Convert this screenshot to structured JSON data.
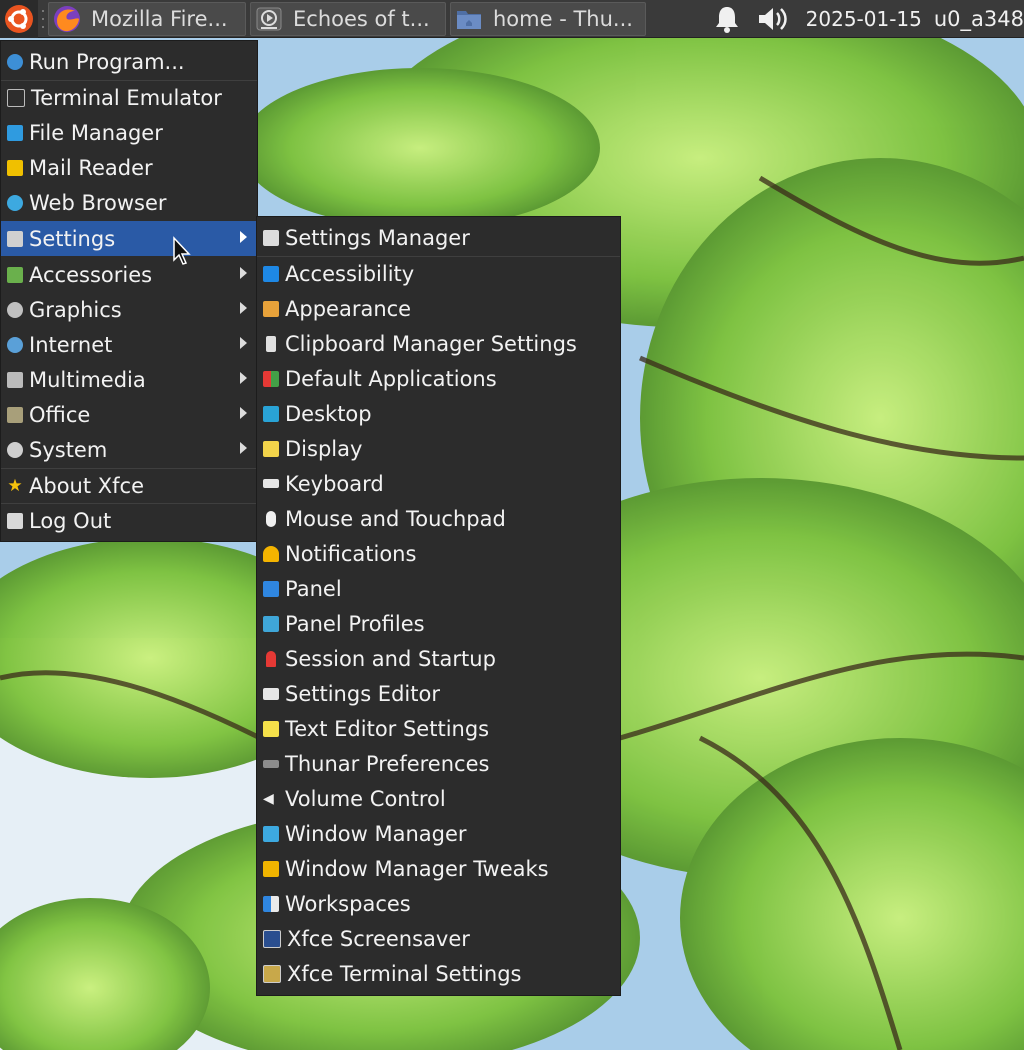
{
  "panel": {
    "tasks": [
      {
        "label": "Mozilla Fire...",
        "icon": "firefox-icon"
      },
      {
        "label": "Echoes of t...",
        "icon": "media-player-icon"
      },
      {
        "label": "home - Thu...",
        "icon": "folder-icon"
      }
    ],
    "clock": "2025-01-15",
    "user": "u0_a348"
  },
  "main_menu": {
    "items": [
      {
        "label": "Run Program...",
        "icon": "run-icon",
        "color": "#3d8fd6",
        "submenu": false
      },
      {
        "label": "Terminal Emulator",
        "icon": "terminal-icon",
        "color": "#2d2d2d",
        "submenu": false
      },
      {
        "label": "File Manager",
        "icon": "file-manager-icon",
        "color": "#2f9be0",
        "submenu": false
      },
      {
        "label": "Mail Reader",
        "icon": "mail-icon",
        "color": "#f0c000",
        "submenu": false
      },
      {
        "label": "Web Browser",
        "icon": "globe-icon",
        "color": "#3da9e0",
        "submenu": false
      },
      {
        "label": "Settings",
        "icon": "settings-icon",
        "color": "#d0d0d0",
        "submenu": true,
        "active": true
      },
      {
        "label": "Accessories",
        "icon": "accessories-icon",
        "color": "#6ab04c",
        "submenu": true
      },
      {
        "label": "Graphics",
        "icon": "graphics-icon",
        "color": "#c0c0c0",
        "submenu": true
      },
      {
        "label": "Internet",
        "icon": "internet-icon",
        "color": "#5aa0d8",
        "submenu": true
      },
      {
        "label": "Multimedia",
        "icon": "multimedia-icon",
        "color": "#bbbbbb",
        "submenu": true
      },
      {
        "label": "Office",
        "icon": "office-icon",
        "color": "#a89f7a",
        "submenu": true
      },
      {
        "label": "System",
        "icon": "system-icon",
        "color": "#cfcfcf",
        "submenu": true
      },
      {
        "label": "About Xfce",
        "icon": "star-icon",
        "color": "#f4c20d",
        "submenu": false
      },
      {
        "label": "Log Out",
        "icon": "logout-icon",
        "color": "#d8d8d8",
        "submenu": false
      }
    ]
  },
  "settings_menu": {
    "items": [
      {
        "label": "Settings Manager",
        "icon": "settings-manager-icon",
        "color": "#dcdcdc"
      },
      {
        "label": "Accessibility",
        "icon": "accessibility-icon",
        "color": "#1e88e5"
      },
      {
        "label": "Appearance",
        "icon": "appearance-icon",
        "color": "#e8a23a"
      },
      {
        "label": "Clipboard Manager Settings",
        "icon": "clipboard-icon",
        "color": "#e0e0e0"
      },
      {
        "label": "Default Applications",
        "icon": "default-apps-icon",
        "color": "#e53935"
      },
      {
        "label": "Desktop",
        "icon": "desktop-icon",
        "color": "#29a3d6"
      },
      {
        "label": "Display",
        "icon": "display-icon",
        "color": "#f2d34a"
      },
      {
        "label": "Keyboard",
        "icon": "keyboard-icon",
        "color": "#e6e6e6"
      },
      {
        "label": "Mouse and Touchpad",
        "icon": "mouse-icon",
        "color": "#f0f0f0"
      },
      {
        "label": "Notifications",
        "icon": "bell-icon",
        "color": "#f4b400"
      },
      {
        "label": "Panel",
        "icon": "panel-icon",
        "color": "#2f86e0"
      },
      {
        "label": "Panel Profiles",
        "icon": "panel-profiles-icon",
        "color": "#3fa6d8"
      },
      {
        "label": "Session and Startup",
        "icon": "rocket-icon",
        "color": "#e53935"
      },
      {
        "label": "Settings Editor",
        "icon": "settings-editor-icon",
        "color": "#e6e6e6"
      },
      {
        "label": "Text Editor Settings",
        "icon": "text-editor-icon",
        "color": "#f5e04a"
      },
      {
        "label": "Thunar Preferences",
        "icon": "thunar-prefs-icon",
        "color": "#8d8d8d"
      },
      {
        "label": "Volume Control",
        "icon": "volume-icon",
        "color": "#eeeeee"
      },
      {
        "label": "Window Manager",
        "icon": "window-manager-icon",
        "color": "#3da9e0"
      },
      {
        "label": "Window Manager Tweaks",
        "icon": "wm-tweaks-icon",
        "color": "#f0b400"
      },
      {
        "label": "Workspaces",
        "icon": "workspaces-icon",
        "color": "#2f86e0"
      },
      {
        "label": "Xfce Screensaver",
        "icon": "screensaver-icon",
        "color": "#2a4e8f"
      },
      {
        "label": "Xfce Terminal Settings",
        "icon": "terminal-settings-icon",
        "color": "#c8a84a"
      }
    ]
  }
}
